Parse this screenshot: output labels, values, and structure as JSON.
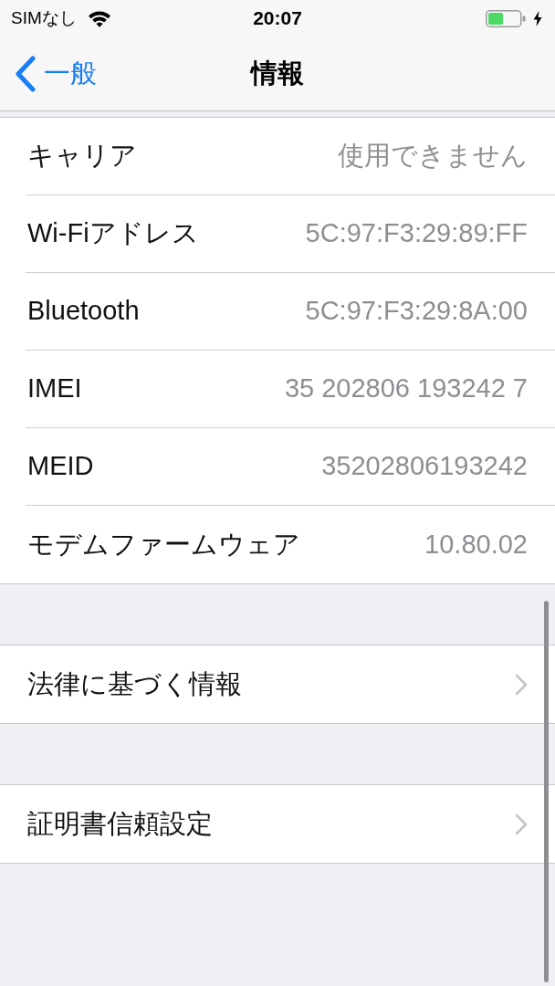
{
  "status_bar": {
    "carrier": "SIMなし",
    "time": "20:07"
  },
  "nav_bar": {
    "back_label": "一般",
    "title": "情報"
  },
  "sections": [
    {
      "rows": [
        {
          "kind": "value",
          "label": "キャリア",
          "value": "使用できません"
        },
        {
          "kind": "value",
          "label": "Wi-Fiアドレス",
          "value": "5C:97:F3:29:89:FF"
        },
        {
          "kind": "value",
          "label": "Bluetooth",
          "value": "5C:97:F3:29:8A:00"
        },
        {
          "kind": "value",
          "label": "IMEI",
          "value": "35 202806 193242 7"
        },
        {
          "kind": "value",
          "label": "MEID",
          "value": "35202806193242"
        },
        {
          "kind": "value",
          "label": "モデムファームウェア",
          "value": "10.80.02"
        }
      ]
    },
    {
      "rows": [
        {
          "kind": "link",
          "label": "法律に基づく情報"
        }
      ]
    },
    {
      "rows": [
        {
          "kind": "link",
          "label": "証明書信頼設定"
        }
      ]
    }
  ]
}
